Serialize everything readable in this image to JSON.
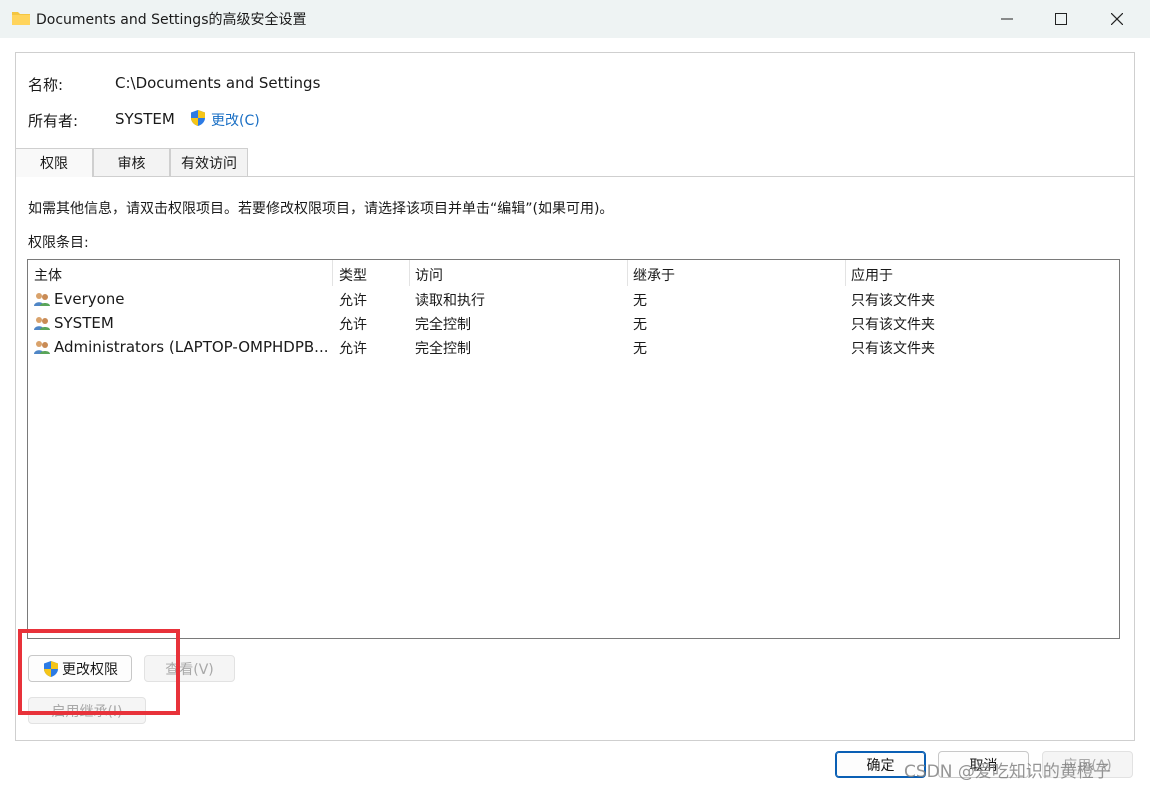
{
  "window": {
    "title": "Documents and Settings的高级安全设置",
    "icon": "folder-icon"
  },
  "fields": {
    "name_label": "名称:",
    "name_value": "C:\\Documents and Settings",
    "owner_label": "所有者:",
    "owner_value": "SYSTEM",
    "owner_change_link": "更改(C)"
  },
  "tabs": [
    "权限",
    "审核",
    "有效访问"
  ],
  "active_tab": "权限",
  "info_text": "如需其他信息，请双击权限项目。若要修改权限项目，请选择该项目并单击“编辑”(如果可用)。",
  "entries_label": "权限条目:",
  "table": {
    "columns": [
      "主体",
      "类型",
      "访问",
      "继承于",
      "应用于"
    ],
    "rows": [
      {
        "principal": "Everyone",
        "type": "允许",
        "access": "读取和执行",
        "inherited": "无",
        "applies": "只有该文件夹"
      },
      {
        "principal": "SYSTEM",
        "type": "允许",
        "access": "完全控制",
        "inherited": "无",
        "applies": "只有该文件夹"
      },
      {
        "principal": "Administrators (LAPTOP-OMPHDPB...",
        "type": "允许",
        "access": "完全控制",
        "inherited": "无",
        "applies": "只有该文件夹"
      }
    ]
  },
  "buttons": {
    "change_permissions": "更改权限",
    "view": "查看(V)",
    "enable_inheritance": "启用继承(I)",
    "ok": "确定",
    "cancel": "取消",
    "apply": "应用(A)"
  },
  "watermark": "CSDN @爱吃知识的黄橙子",
  "colors": {
    "accent": "#1a6fc4",
    "highlight_box": "#e8323a",
    "titlebar": "#eef3f3"
  }
}
